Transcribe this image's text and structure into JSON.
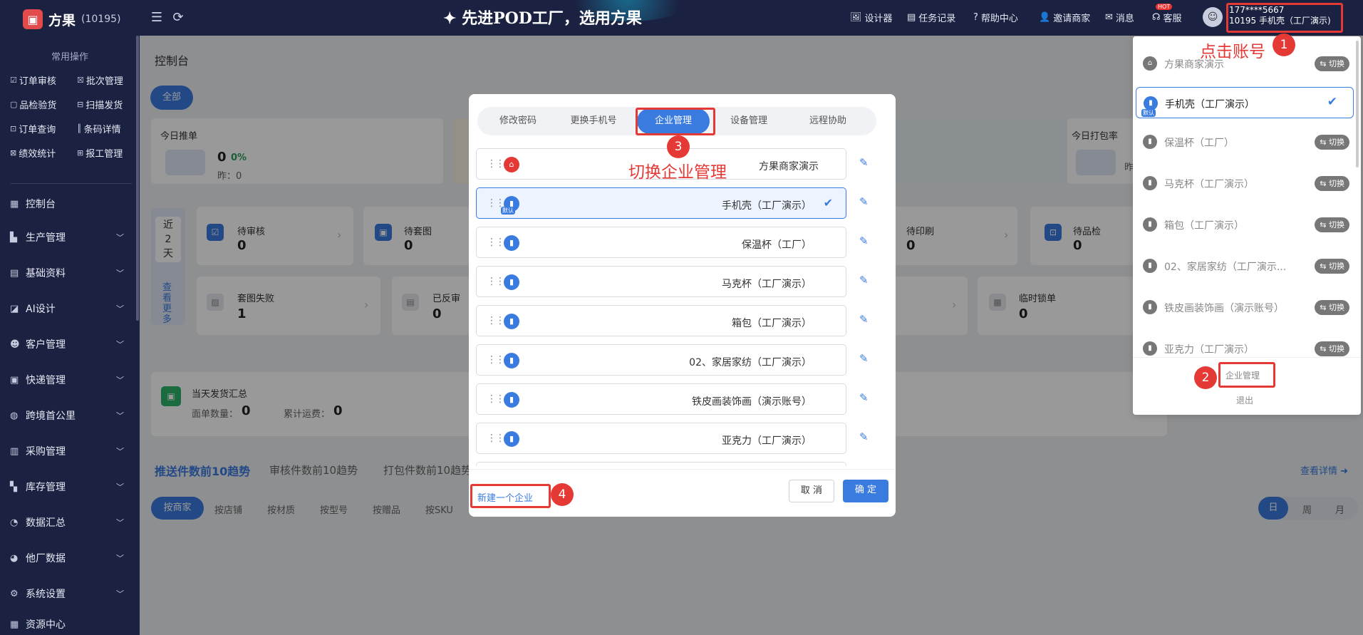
{
  "header": {
    "app_name": "方果",
    "app_id": "(10195)",
    "slogan": "先进POD工厂，选用方果",
    "nav": [
      {
        "label": "设计器",
        "icon": "image-icon"
      },
      {
        "label": "任务记录",
        "icon": "task-icon"
      },
      {
        "label": "帮助中心",
        "icon": "help-icon"
      },
      {
        "label": "邀请商家",
        "icon": "user-add-icon"
      },
      {
        "label": "消息",
        "icon": "message-icon"
      },
      {
        "label": "客服",
        "icon": "headset-icon"
      }
    ],
    "hot_badge": "HOT",
    "account_phone": "177****5667",
    "account_company": "10195 手机壳（工厂演示)"
  },
  "sidebar": {
    "common_title": "常用操作",
    "quick_actions": [
      "订单审核",
      "批次管理",
      "品检验货",
      "扫描发货",
      "订单查询",
      "条码详情",
      "绩效统计",
      "报工管理"
    ],
    "menu": [
      "控制台",
      "生产管理",
      "基础资料",
      "AI设计",
      "客户管理",
      "快递管理",
      "跨境首公里",
      "采购管理",
      "库存管理",
      "数据汇总",
      "他厂数据",
      "系统设置",
      "资源中心"
    ]
  },
  "main": {
    "breadcrumb": "控制台",
    "filter_all": "全部",
    "cards_top": [
      {
        "title": "今日推单",
        "value": "0",
        "pct": "0%",
        "yesterday": "昨：0"
      },
      {
        "title": "今日打包率",
        "value": "",
        "pct": "",
        "yesterday": "昨"
      }
    ],
    "period": {
      "label": "近2天",
      "more": "查看更多"
    },
    "stats_row1": [
      {
        "title": "待审核",
        "value": "0"
      },
      {
        "title": "待套图",
        "value": "0"
      },
      {
        "title": "待印刷",
        "value": "0"
      },
      {
        "title": "待品检",
        "value": "0"
      }
    ],
    "stats_row2": [
      {
        "title": "套图失败",
        "value": "1"
      },
      {
        "title": "已反审",
        "value": "0"
      },
      {
        "title": "临时锁单",
        "value": "0"
      }
    ],
    "ship_summary": {
      "title": "当天发货汇总",
      "count_label": "面单数量：",
      "count": "0",
      "fee_label": "累计运费：",
      "fee": "0"
    },
    "trend_tabs": [
      "推送件数前10趋势",
      "审核件数前10趋势",
      "打包件数前10趋势"
    ],
    "view_detail": "查看详情",
    "group_tabs": [
      "按商家",
      "按店铺",
      "按材质",
      "按型号",
      "按赠品",
      "按SKU"
    ],
    "time_tabs": [
      "日",
      "周",
      "月"
    ]
  },
  "modal": {
    "tabs": [
      "修改密码",
      "更换手机号",
      "企业管理",
      "设备管理",
      "远程协助"
    ],
    "active_tab": "企业管理",
    "companies": [
      {
        "name": "方果商家演示",
        "icon": "shop-icon"
      },
      {
        "name": "手机壳（工厂演示）",
        "icon": "factory-icon",
        "selected": true,
        "badge": "默认"
      },
      {
        "name": "保温杯（工厂）",
        "icon": "factory-icon"
      },
      {
        "name": "马克杯（工厂演示）",
        "icon": "factory-icon"
      },
      {
        "name": "箱包（工厂演示）",
        "icon": "factory-icon"
      },
      {
        "name": "02、家居家纺（工厂演示）",
        "icon": "factory-icon"
      },
      {
        "name": "铁皮画装饰画（演示账号）",
        "icon": "factory-icon"
      },
      {
        "name": "亚克力（工厂演示）",
        "icon": "factory-icon"
      }
    ],
    "new_company": "新建一个企业",
    "cancel": "取 消",
    "confirm": "确 定"
  },
  "dropdown": {
    "items": [
      {
        "name": "方果商家演示",
        "switch": "⇆ 切换"
      },
      {
        "name": "手机壳（工厂演示）",
        "selected": true,
        "badge": "默认"
      },
      {
        "name": "保温杯（工厂）",
        "switch": "⇆ 切换"
      },
      {
        "name": "马克杯（工厂演示）",
        "switch": "⇆ 切换"
      },
      {
        "name": "箱包（工厂演示）",
        "switch": "⇆ 切换"
      },
      {
        "name": "02、家居家纺（工厂演示...",
        "switch": "⇆ 切换"
      },
      {
        "name": "铁皮画装饰画（演示账号）",
        "switch": "⇆ 切换"
      },
      {
        "name": "亚克力（工厂演示）",
        "switch": "⇆ 切换"
      }
    ],
    "company_mgmt": "企业管理",
    "logout": "退出"
  },
  "annotations": {
    "step1": "1",
    "step1_text": "点击账号",
    "step2": "2",
    "step3": "3",
    "step3_text": "切换企业管理",
    "step4": "4"
  },
  "colors": {
    "accent": "#3a7be0",
    "sidebar": "#1b2140",
    "annotation": "#e53935"
  }
}
